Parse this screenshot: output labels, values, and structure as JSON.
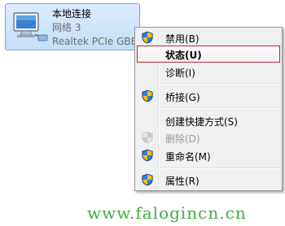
{
  "adapter": {
    "name": "本地连接",
    "network": "网络  3",
    "device": "Realtek PCIe GBE",
    "icon": "network-adapter-icon"
  },
  "context_menu": {
    "items": [
      {
        "label": "禁用(B)",
        "icon": "uac-shield-icon",
        "state": "normal"
      },
      {
        "label": "状态(U)",
        "icon": null,
        "state": "highlighted"
      },
      {
        "label": "诊断(I)",
        "icon": null,
        "state": "normal"
      },
      {
        "label": "桥接(G)",
        "icon": "uac-shield-icon",
        "state": "normal"
      },
      {
        "label": "创建快捷方式(S)",
        "icon": null,
        "state": "normal"
      },
      {
        "label": "删除(D)",
        "icon": "uac-shield-icon",
        "state": "disabled"
      },
      {
        "label": "重命名(M)",
        "icon": "uac-shield-icon",
        "state": "normal"
      },
      {
        "label": "属性(R)",
        "icon": "uac-shield-icon",
        "state": "normal"
      }
    ]
  },
  "watermark": "www.falogincn.cn",
  "colors": {
    "selection_border": "#c2253b",
    "tile_border": "#7da2ce",
    "watermark": "#3fae3f"
  }
}
